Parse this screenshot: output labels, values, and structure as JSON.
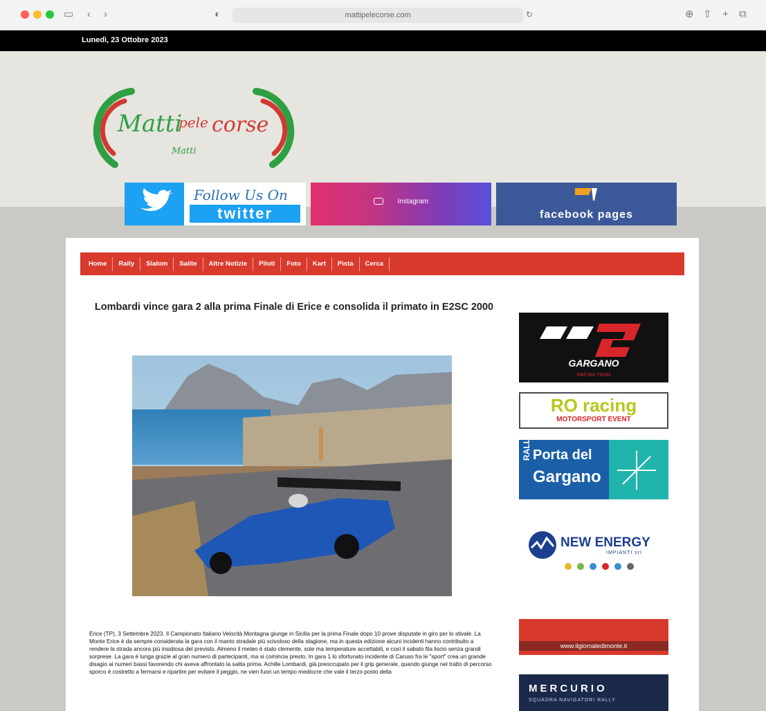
{
  "browser": {
    "url": "mattipelecorse.com"
  },
  "topbar": {
    "date": "Lunedì, 23 Ottobre 2023"
  },
  "social": {
    "twitter_line1": "Follow Us On",
    "twitter_line2": "twitter",
    "instagram_label": "Instagram",
    "facebook_label": "facebook pages"
  },
  "nav": {
    "items": [
      "Home",
      "Rally",
      "Slalom",
      "Salite",
      "Altre Notizie",
      "Piloti",
      "Foto",
      "Kart",
      "Pista",
      "Cerca"
    ]
  },
  "article": {
    "title": "Lombardi vince gara 2 alla prima Finale di Erice e consolida il primato in E2SC 2000",
    "body": "Erice (TP), 3 Settembre 2023. Il Campionato Italiano Velocità Montagna giunge in Sicilia per la prima Finale dopo 10 prove disputate in giro per lo stivale. La Monte Erice è da sempre considerata la gara con il manto stradale più scivoloso della stagione, ma in questa edizione alcuni incidenti hanno contribuito a rendere la strada ancora più insidiosa del previsto. Almeno il meteo è stato clemente, sole ma temperature accettabili, e così il sabato fila liscio senza grandi sorprese. La gara è lunga grazie al gran numero di partecipanti, ma si comincia presto. In gara 1 lo sfortunato incidente di Caruso fra le \"sport\" crea un grande disagio ai numeri bassi favorendo chi aveva affrontato la salita prima. Achille Lombardi, già preoccupato per il grip generale, quando giunge nel tratto di percorso sporco è costretto a fermarsi e ripartire per evitare il peggio, ne vien fuori un tempo mediocre che vale il terzo posto della"
  },
  "sidebar": {
    "gargano_label": "GARGANO",
    "gargano_sub": "RACING TEAM",
    "ro_label": "RO racing",
    "ro_sub": "MOTORSPORT EVENT",
    "porta_side": "RALLY",
    "porta_line1": "Porta del",
    "porta_line2": "Gargano",
    "energy_label": "NEW ENERGY",
    "energy_sub": "IMPIANTI srl",
    "giornale_label": "www.ilgiornaledimonte.it",
    "mercurio_label": "MERCURIO",
    "mercurio_sub": "SQUADRA NAVIGATORI RALLY"
  },
  "colors": {
    "nav_red": "#d93a2e",
    "twitter_blue": "#1da1f2",
    "facebook_blue": "#3b5998"
  }
}
